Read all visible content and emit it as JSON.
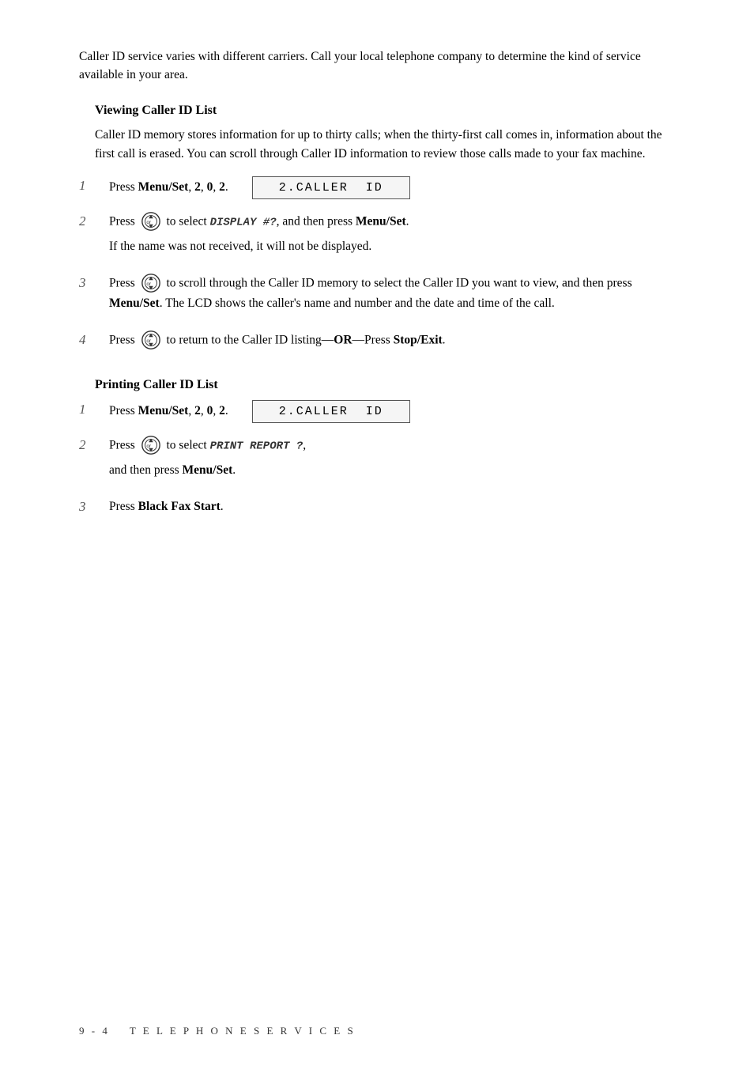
{
  "page": {
    "intro": "Caller ID service varies with different carriers.  Call your local telephone company to determine the kind of service available in your area.",
    "section1": {
      "title": "Viewing Caller ID List",
      "desc": "Caller ID memory stores information for up to thirty calls; when the thirty-first call comes in, information about the first call is erased.  You can scroll through Caller ID information to review those calls made to your fax machine.",
      "steps": [
        {
          "number": "1",
          "text_pre": "Press ",
          "text_bold": "Menu/Set",
          "text_post": ", 2, 0, 2.",
          "lcd": "2.CALLER  ID"
        },
        {
          "number": "2",
          "text_pre": "Press ",
          "text_has_icon": true,
          "text_mid": " to select ",
          "text_code": "DISPLAY #?",
          "text_post": ", and then press ",
          "text_bold_end": "Menu/Set",
          "text_end": ".",
          "sub": "If the name was not received, it will not be displayed."
        },
        {
          "number": "3",
          "text_pre": "Press ",
          "text_has_icon": true,
          "text_mid": " to scroll through the Caller ID memory to select the Caller ID you want to view, and then press ",
          "text_bold_mid": "Menu/Set",
          "text_post": ". The LCD shows the caller's name and number and the date and time of the call."
        },
        {
          "number": "4",
          "text_pre": "Press ",
          "text_has_icon": true,
          "text_mid": " to return to the Caller ID listing—OR—Press ",
          "text_bold_end": "Stop/Exit",
          "text_end": "."
        }
      ]
    },
    "section2": {
      "title": "Printing Caller ID List",
      "steps": [
        {
          "number": "1",
          "text_pre": "Press ",
          "text_bold": "Menu/Set",
          "text_post": ", 2, 0, 2.",
          "lcd": "2.CALLER  ID"
        },
        {
          "number": "2",
          "text_pre": "Press ",
          "text_has_icon": true,
          "text_mid": " to select ",
          "text_code": "PRINT REPORT ?",
          "text_post": ",",
          "sub": "and then press Menu/Set.",
          "sub_bold": "Menu/Set"
        },
        {
          "number": "3",
          "text_pre": "Press ",
          "text_bold": "Black Fax Start",
          "text_post": "."
        }
      ]
    },
    "footer": {
      "page": "9 - 4",
      "label": "T E L E P H O N E   S E R V I C E S"
    }
  }
}
